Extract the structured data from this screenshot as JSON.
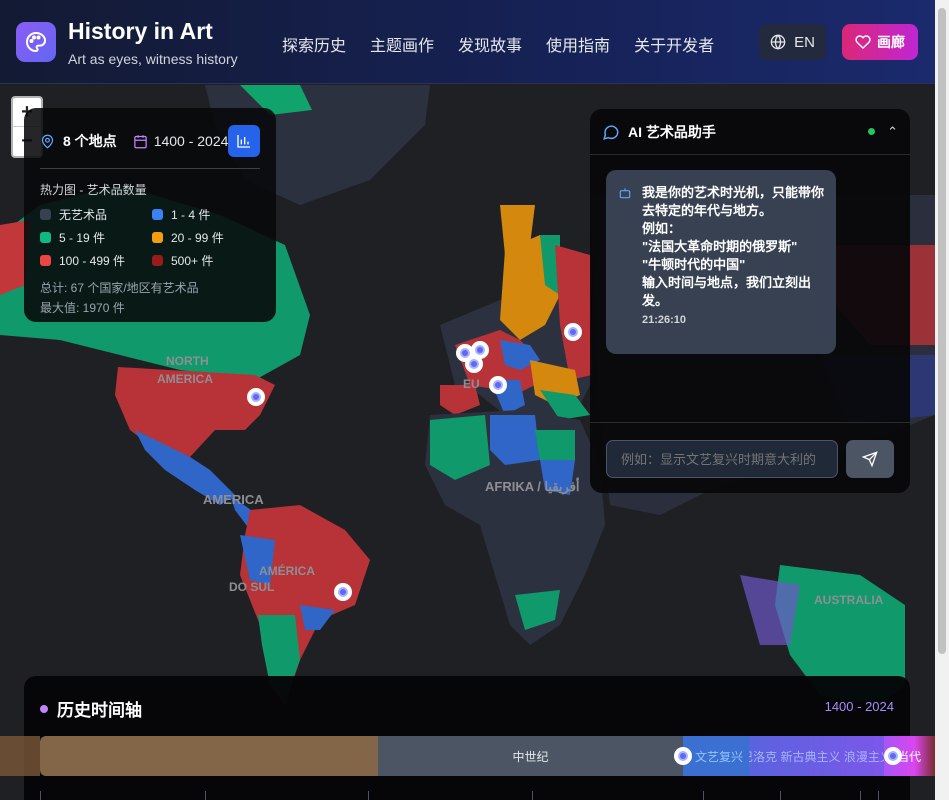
{
  "header": {
    "title": "History in Art",
    "subtitle": "Art as eyes, witness history",
    "nav": [
      "探索历史",
      "主题画作",
      "发现故事",
      "使用指南",
      "关于开发者"
    ],
    "lang_label": "EN",
    "gallery_label": "画廊"
  },
  "zoom": {
    "in": "+",
    "out": "−"
  },
  "map_labels": {
    "north_america_1": "NORTH",
    "north_america_2": "AMERICA",
    "south_america_top": "AMERICA",
    "south_america_1": "AMÉRICA",
    "south_america_2": "DO SUL",
    "africa": "AFRIKA / أفريقيا",
    "europe": "EU",
    "australia": "AUSTRALIA"
  },
  "stats": {
    "locations": "8 个地点",
    "range": "1400 - 2024",
    "legend_title": "热力图 - 艺术品数量",
    "legend": [
      {
        "label": "无艺术品",
        "color": "#374151"
      },
      {
        "label": "1 - 4 件",
        "color": "#3b82f6"
      },
      {
        "label": "5 - 19 件",
        "color": "#10b981"
      },
      {
        "label": "20 - 99 件",
        "color": "#f59e0b"
      },
      {
        "label": "100 - 499 件",
        "color": "#ef4444"
      },
      {
        "label": "500+ 件",
        "color": "#991b1b"
      }
    ],
    "total": "总计: 67 个国家/地区有艺术品",
    "max": "最大值: 1970 件"
  },
  "chat": {
    "title": "AI 艺术品助手",
    "message": "我是你的艺术时光机，只能带你去特定的年代与地方。\n例如：\n\"法国大革命时期的俄罗斯\"\n\"牛顿时代的中国\"\n输入时间与地点，我们立刻出发。",
    "time": "21:26:10",
    "placeholder": "例如：显示文艺复兴时期意大利的"
  },
  "timeline": {
    "title": "历史时间轴",
    "range": "1400 - 2024",
    "segments": [
      {
        "label": "",
        "color": "#8b6a4a"
      },
      {
        "label": "中世纪",
        "color": "#4b5563"
      },
      {
        "label": "文艺复兴",
        "color": "#3b6fd1"
      },
      {
        "label": "巴洛克 新古典主义 浪漫主义",
        "color": "#6d5ee0"
      },
      {
        "label": "当代",
        "color": "#a855f7"
      }
    ]
  }
}
